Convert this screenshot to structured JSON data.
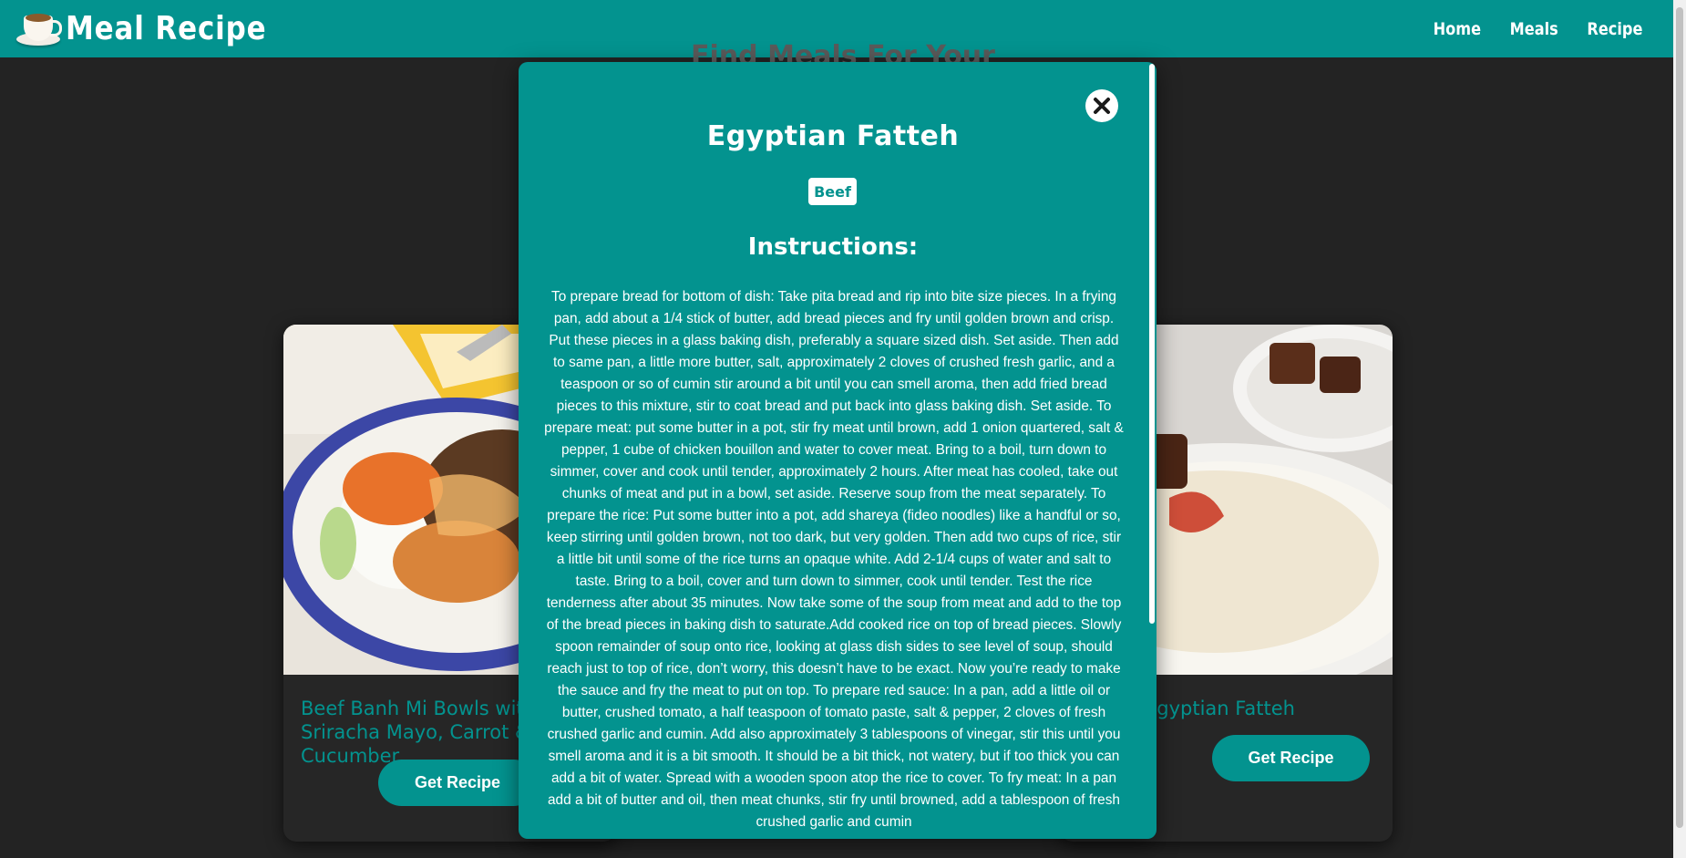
{
  "navbar": {
    "brand_title": "Meal Recipe",
    "logo_icon": "coffee-cup-icon",
    "links": [
      "Home",
      "Meals",
      "Recipe"
    ],
    "background_color": "#03938f"
  },
  "background_heading": "Find Meals For Your Ingredients",
  "cards": [
    {
      "title": "Beef Banh Mi Bowls with Sriracha Mayo, Carrot & Pickled Cucumber",
      "button_label": "Get Recipe"
    },
    {
      "title": "Egyptian Fatteh",
      "button_label": "Get Recipe"
    }
  ],
  "modal": {
    "title": "Egyptian Fatteh",
    "category": "Beef",
    "instructions_heading": "Instructions:",
    "instructions": "To prepare bread for bottom of dish: Take pita bread and rip into bite size pieces. In a frying pan, add about a 1/4 stick of butter, add bread pieces and fry until golden brown and crisp. Put these pieces in a glass baking dish, preferably a square sized dish. Set aside. Then add to same pan, a little more butter, salt, approximately 2 cloves of crushed fresh garlic, and a teaspoon or so of cumin stir around a bit until you can smell aroma, then add fried bread pieces to this mixture, stir to coat bread and put back into glass baking dish. Set aside. To prepare meat: put some butter in a pot, stir fry meat until brown, add 1 onion quartered, salt & pepper, 1 cube of chicken bouillon and water to cover meat. Bring to a boil, turn down to simmer, cover and cook until tender, approximately 2 hours. After meat has cooled, take out chunks of meat and put in a bowl, set aside. Reserve soup from the meat separately. To prepare the rice: Put some butter into a pot, add shareya (fideo noodles) like a handful or so, keep stirring until golden brown, not too dark, but very golden. Then add two cups of rice, stir a little bit until some of the rice turns an opaque white. Add 2-1/4 cups of water and salt to taste. Bring to a boil, cover and turn down to simmer, cook until tender. Test the rice tenderness after about 35 minutes. Now take some of the soup from meat and add to the top of the bread pieces in baking dish to saturate.Add cooked rice on top of bread pieces. Slowly spoon remainder of soup onto rice, looking at glass dish sides to see level of soup, should reach just to top of rice, don’t worry, this doesn’t have to be exact. Now you’re ready to make the sauce and fry the meat to put on top. To prepare red sauce: In a pan, add a little oil or butter, crushed tomato, a half teaspoon of tomato paste, salt & pepper, 2 cloves of fresh crushed garlic and cumin. Add also approximately 3 tablespoons of vinegar, stir this until you smell aroma and it is a bit smooth. It should be a bit thick, not watery, but if too thick you can add a bit of water. Spread with a wooden spoon atop the rice to cover. To fry meat: In a pan add a bit of butter and oil, then meat chunks, stir fry until browned, add a tablespoon of fresh crushed garlic and cumin",
    "close_icon": "close-icon"
  },
  "colors": {
    "accent": "#03938f",
    "page_background": "#232323",
    "card_background": "#262626"
  }
}
